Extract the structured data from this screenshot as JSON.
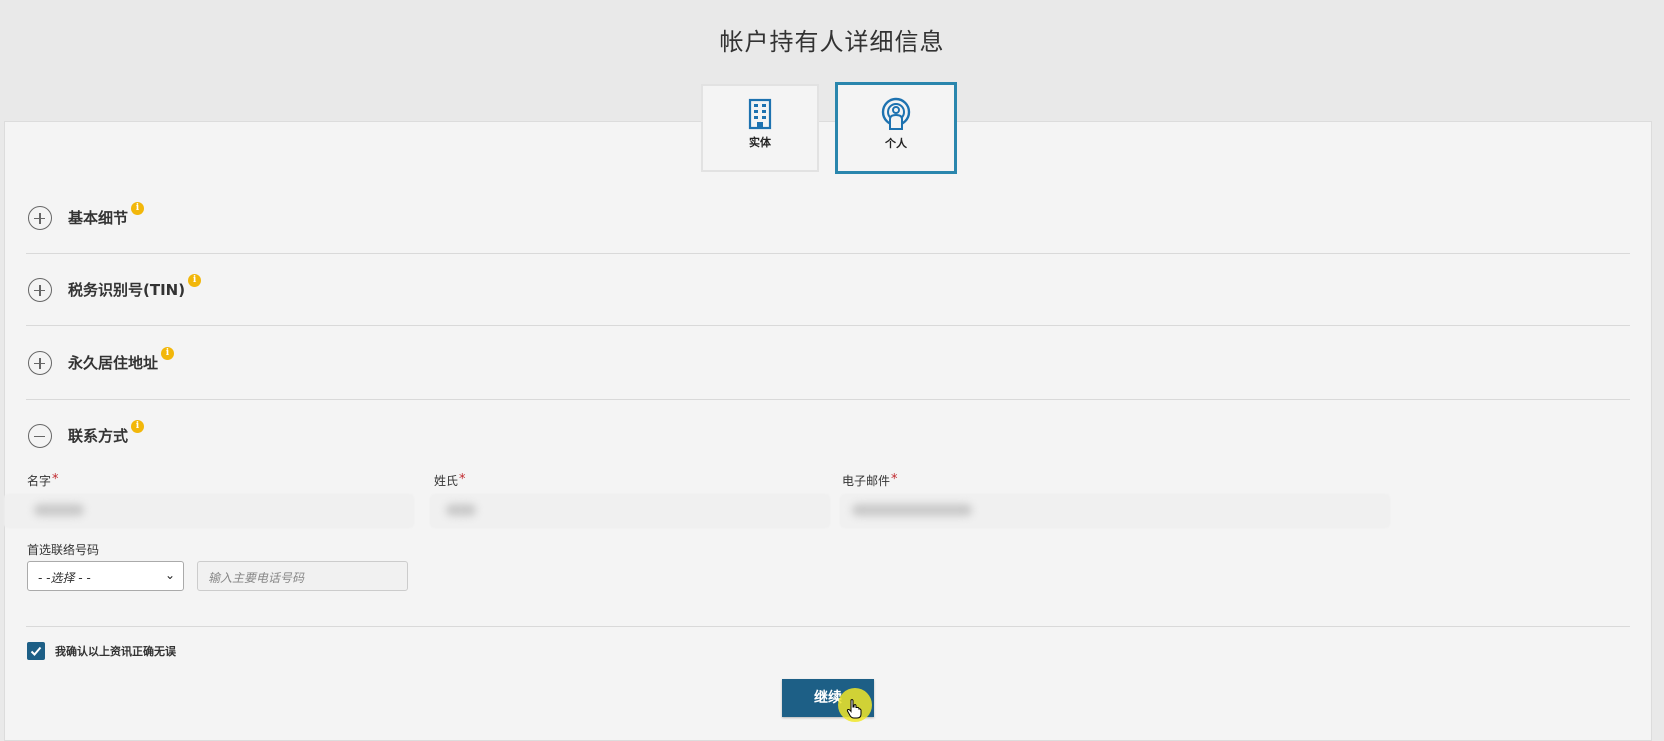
{
  "page": {
    "title": "帐户持有人详细信息"
  },
  "holder_type_tabs": [
    {
      "label": "实体",
      "icon": "building-icon",
      "selected": false
    },
    {
      "label": "个人",
      "icon": "person-icon",
      "selected": true
    }
  ],
  "sections": [
    {
      "label": "基本细节",
      "expanded": false
    },
    {
      "label": "税务识别号(TIN)",
      "expanded": false
    },
    {
      "label": "永久居住地址",
      "expanded": false
    },
    {
      "label": "联系方式",
      "expanded": true
    }
  ],
  "info_icon_glyph": "i",
  "contact": {
    "first_name_label": "名字",
    "last_name_label": "姓氏",
    "email_label": "电子邮件",
    "required_marker": "*",
    "preferred_phone_label": "首选联络号码",
    "phone_type_select": {
      "value": "- -选择 - -"
    },
    "phone_input": {
      "placeholder": "输入主要电话号码",
      "value": ""
    }
  },
  "confirmation": {
    "checked": true,
    "label": "我确认以上资讯正确无误"
  },
  "continue_button": {
    "label": "继续"
  },
  "colors": {
    "accent": "#2a86ad",
    "primary_button": "#1d5f86",
    "info_badge": "#f2b70a",
    "required": "#c0282d",
    "cursor_highlight": "#f0e628"
  }
}
